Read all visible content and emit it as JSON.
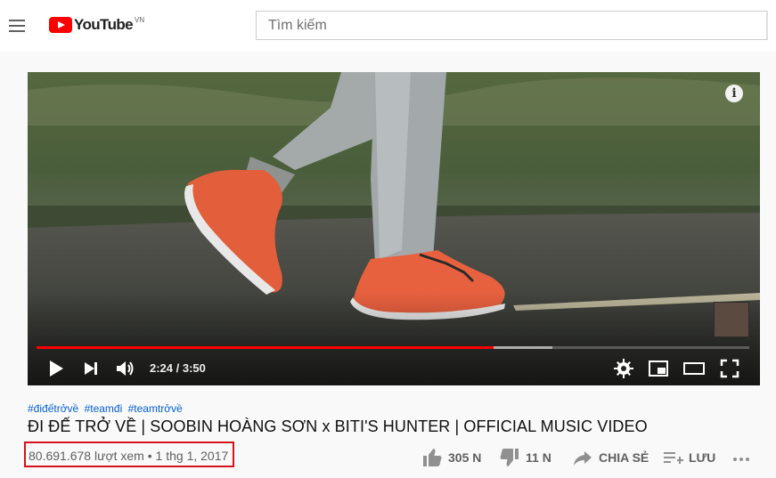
{
  "header": {
    "logo_text": "YouTube",
    "logo_country": "VN",
    "search_placeholder": "Tìm kiếm"
  },
  "player": {
    "time_current": "2:24",
    "time_separator": " / ",
    "time_total": "3:50",
    "played_fraction": 0.6414,
    "buffered_fraction": 0.7234,
    "info_label": "i"
  },
  "video": {
    "hashtags": [
      "#điđếtrởvề",
      "#teamđi",
      "#teamtrởvề"
    ],
    "title": "ĐI ĐẾ TRỞ VỀ | SOOBIN HOÀNG SƠN x BITI'S HUNTER | OFFICIAL MUSIC VIDEO",
    "views": "80.691.678 lượt xem",
    "separator": " • ",
    "date": "1 thg 1, 2017"
  },
  "actions": {
    "like_count": "305 N",
    "dislike_count": "11 N",
    "share_label": "CHIA SẺ",
    "save_label": "LƯU"
  },
  "colors": {
    "accent": "#ff0000",
    "highlight_box": "#d4131b",
    "hashtag": "#065fd4"
  }
}
